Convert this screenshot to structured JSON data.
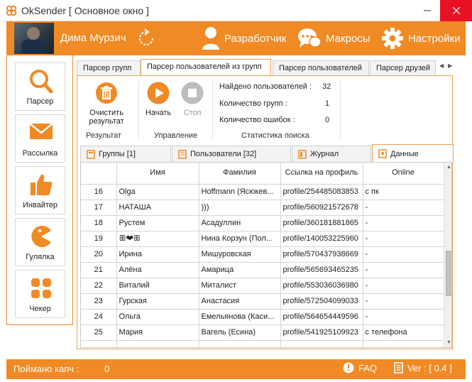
{
  "window": {
    "title": "OkSender [ Основное окно ]"
  },
  "header": {
    "user_name": "Дима Мурзич",
    "developer_label": "Разработчик",
    "macros_label": "Макросы",
    "settings_label": "Настройки"
  },
  "sidebar": {
    "items": [
      {
        "label": "Парсер",
        "icon": "search-icon"
      },
      {
        "label": "Рассылка",
        "icon": "mail-icon"
      },
      {
        "label": "Инвайтер",
        "icon": "thumbs-up-icon"
      },
      {
        "label": "Гулялка",
        "icon": "pacman-icon"
      },
      {
        "label": "Чекер",
        "icon": "grid-dots-icon"
      }
    ]
  },
  "top_tabs": [
    {
      "label": "Парсер групп"
    },
    {
      "label": "Парсер пользователей из групп"
    },
    {
      "label": "Парсер пользователей"
    },
    {
      "label": "Парсер друзей"
    }
  ],
  "toolbar": {
    "clear_label": "Очистить результат",
    "result_group": "Результат",
    "start_label": "Начать",
    "stop_label": "Стоп",
    "control_group": "Управление",
    "stats_group": "Статистика поиска"
  },
  "stats": {
    "users_found_label": "Найдено пользователей :",
    "users_found": "32",
    "groups_label": "Количество групп :",
    "groups": "1",
    "errors_label": "Количество ошибок :",
    "errors": "0"
  },
  "inner_tabs": [
    {
      "label": "Группы [1]"
    },
    {
      "label": "Пользователи [32]"
    },
    {
      "label": "Журнал"
    },
    {
      "label": "Данные"
    }
  ],
  "table": {
    "columns": [
      "",
      "Имя",
      "Фамилия",
      "Ссылка на профиль",
      "Online"
    ],
    "rows": [
      {
        "n": "16",
        "name": "Olga",
        "surname": "Hoffmann (Ясюкев...",
        "link": "profile/254485083853",
        "online": "с пк"
      },
      {
        "n": "17",
        "name": "НАТАША",
        "surname": ")))",
        "link": "profile/560921572678",
        "online": "-"
      },
      {
        "n": "18",
        "name": "Рустем",
        "surname": "Асадуллин",
        "link": "profile/360181881865",
        "online": "-"
      },
      {
        "n": "19",
        "name": "ꕥ❤ꕥ",
        "surname": "Нина Корзун (Пол...",
        "link": "profile/140053225960",
        "online": "-"
      },
      {
        "n": "20",
        "name": "Ирина",
        "surname": "Мишуровская",
        "link": "profile/570437938669",
        "online": "-"
      },
      {
        "n": "21",
        "name": "Алёна",
        "surname": "Амарица",
        "link": "profile/565693465235",
        "online": "-"
      },
      {
        "n": "22",
        "name": "Виталий",
        "surname": "Миталист",
        "link": "profile/553036036980",
        "online": "-"
      },
      {
        "n": "23",
        "name": "Гурская",
        "surname": "Анастасия",
        "link": "profile/572504099033",
        "online": "-"
      },
      {
        "n": "24",
        "name": "Ольга",
        "surname": "Емельянова (Каси...",
        "link": "profile/564654449596",
        "online": "-"
      },
      {
        "n": "25",
        "name": "Мария",
        "surname": "Вагель (Есина)",
        "link": "profile/541925109923",
        "online": "с телефона"
      }
    ]
  },
  "footer": {
    "captcha_label": "Поймано капч :",
    "captcha_value": "0",
    "faq_label": "FAQ",
    "version_label": "Ver : [ 0.4 ]"
  },
  "colors": {
    "accent": "#f08a24",
    "close": "#e81123"
  }
}
